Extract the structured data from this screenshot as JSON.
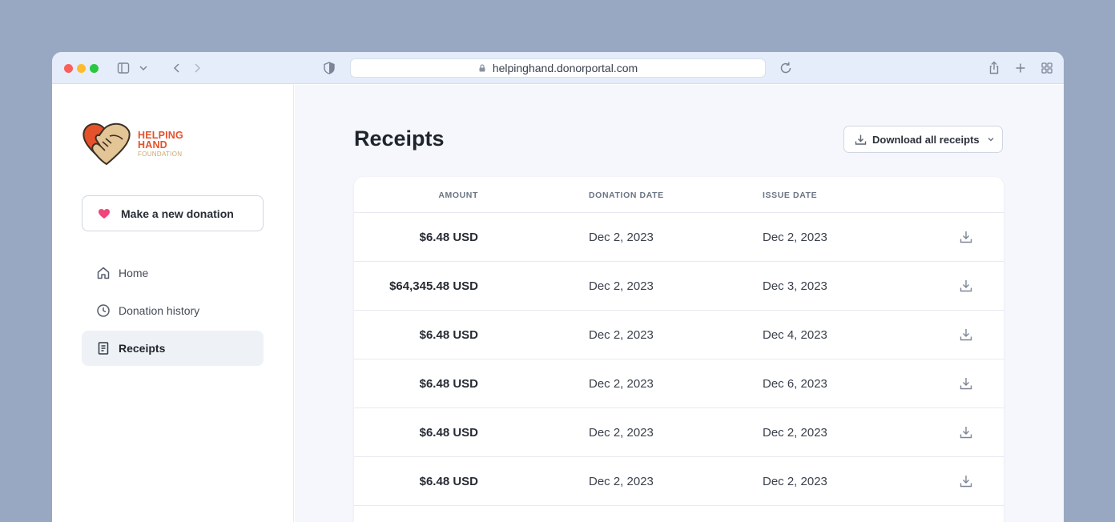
{
  "browser": {
    "url": "helpinghand.donorportal.com"
  },
  "logo": {
    "line1": "HELPING",
    "line2": "HAND",
    "line3": "FOUNDATION"
  },
  "sidebar": {
    "donate_label": "Make a new donation",
    "items": [
      {
        "label": "Home",
        "icon": "home-icon"
      },
      {
        "label": "Donation history",
        "icon": "clock-icon"
      },
      {
        "label": "Receipts",
        "icon": "receipt-icon",
        "active": true
      }
    ]
  },
  "main": {
    "title": "Receipts",
    "download_all_label": "Download all receipts"
  },
  "table": {
    "headers": {
      "amount": "AMOUNT",
      "donation_date": "DONATION DATE",
      "issue_date": "ISSUE DATE"
    },
    "rows": [
      {
        "amount": "$6.48 USD",
        "donation_date": "Dec 2, 2023",
        "issue_date": "Dec 2, 2023"
      },
      {
        "amount": "$64,345.48 USD",
        "donation_date": "Dec 2, 2023",
        "issue_date": "Dec 3, 2023"
      },
      {
        "amount": "$6.48 USD",
        "donation_date": "Dec 2, 2023",
        "issue_date": "Dec 4, 2023"
      },
      {
        "amount": "$6.48 USD",
        "donation_date": "Dec 2, 2023",
        "issue_date": "Dec 6, 2023"
      },
      {
        "amount": "$6.48 USD",
        "donation_date": "Dec 2, 2023",
        "issue_date": "Dec 2, 2023"
      },
      {
        "amount": "$6.48 USD",
        "donation_date": "Dec 2, 2023",
        "issue_date": "Dec 2, 2023"
      }
    ]
  },
  "colors": {
    "backdrop": "#98a8c2",
    "brand_red": "#e4512b",
    "brand_tan": "#c9a86d",
    "heart_pink": "#f0457a"
  }
}
